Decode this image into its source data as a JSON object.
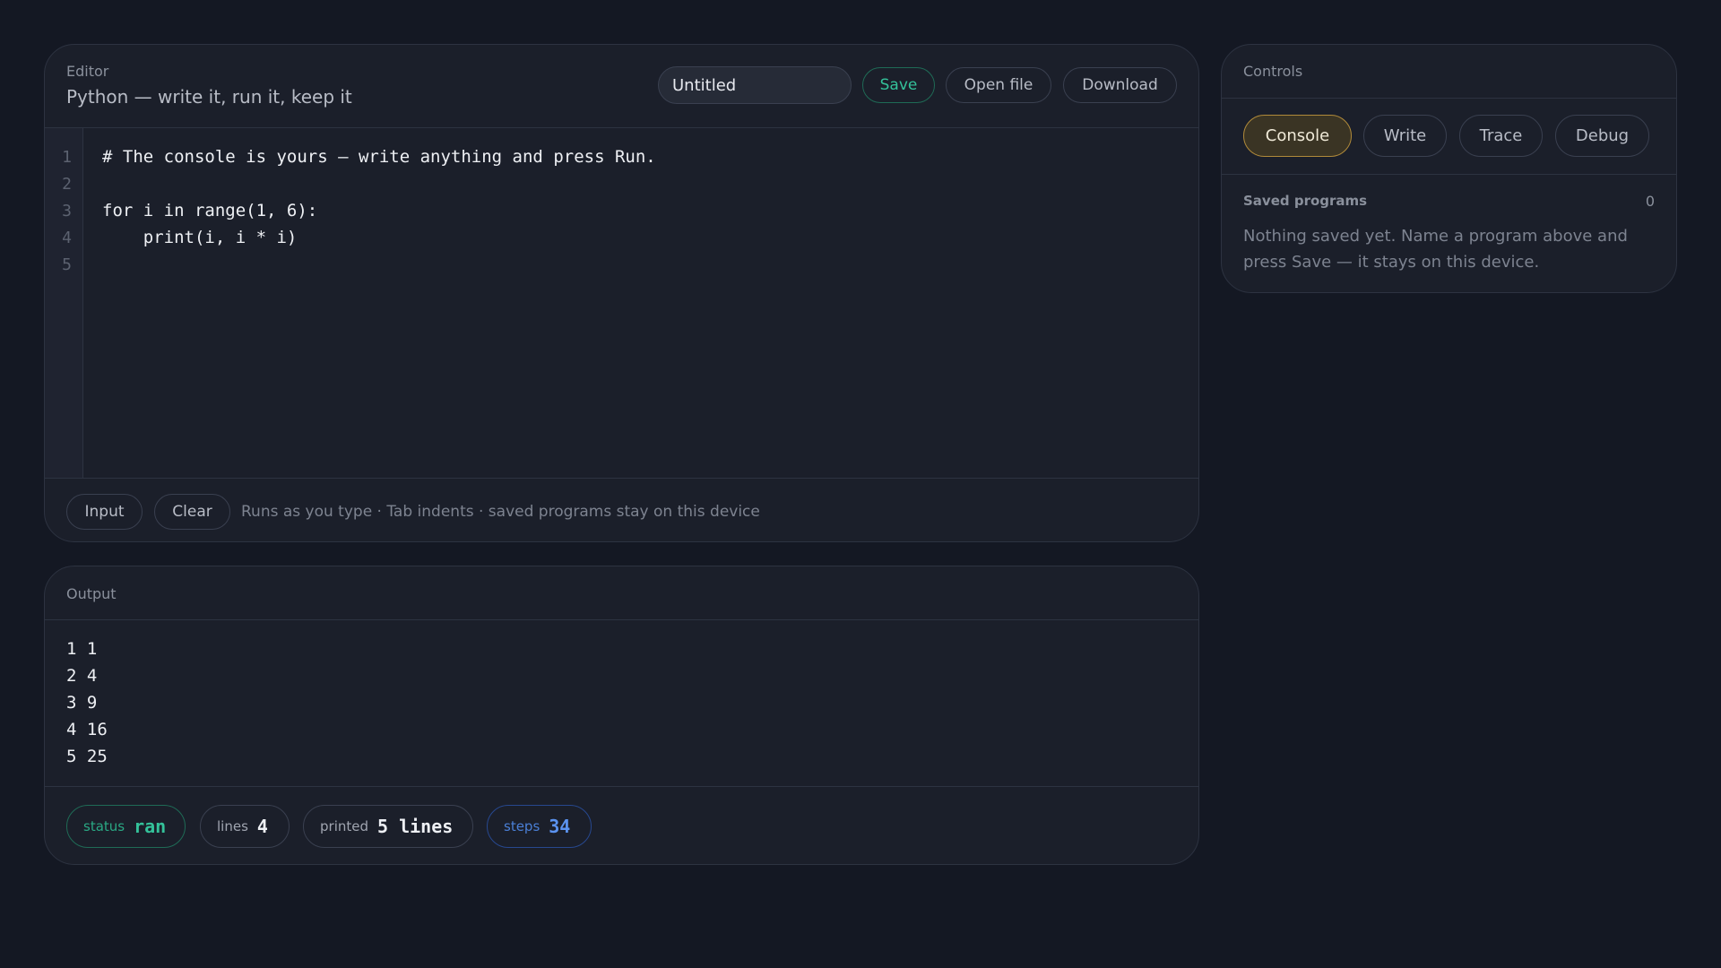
{
  "editor": {
    "label": "Editor",
    "subtitle": "Python — write it, run it, keep it",
    "program_name": "Untitled",
    "save_label": "Save",
    "open_label": "Open file",
    "download_label": "Download",
    "line_numbers": [
      "1",
      "2",
      "3",
      "4",
      "5"
    ],
    "code_lines": [
      "# The console is yours — write anything and press Run.",
      "",
      "for i in range(1, 6):",
      "    print(i, i * i)",
      ""
    ],
    "input_label": "Input",
    "clear_label": "Clear",
    "hint": "Runs as you type · Tab indents · saved programs stay on this device"
  },
  "output": {
    "label": "Output",
    "lines": [
      "1 1",
      "2 4",
      "3 9",
      "4 16",
      "5 25"
    ],
    "badges": {
      "status": {
        "key": "status",
        "value": "ran"
      },
      "lines": {
        "key": "lines",
        "value": "4"
      },
      "printed": {
        "key": "printed",
        "value": "5 lines"
      },
      "steps": {
        "key": "steps",
        "value": "34"
      }
    }
  },
  "controls": {
    "label": "Controls",
    "tabs": [
      "Console",
      "Write",
      "Trace",
      "Debug"
    ],
    "active_tab": "Console",
    "saved_title": "Saved programs",
    "saved_count": "0",
    "saved_empty": "Nothing saved yet. Name a program above and press Save — it stays on this device."
  },
  "colors": {
    "background": "#141823",
    "panel": "#1b1f2a",
    "accent_green": "#34c29a",
    "accent_blue": "#5b93f0",
    "accent_gold": "#b08a3a"
  }
}
